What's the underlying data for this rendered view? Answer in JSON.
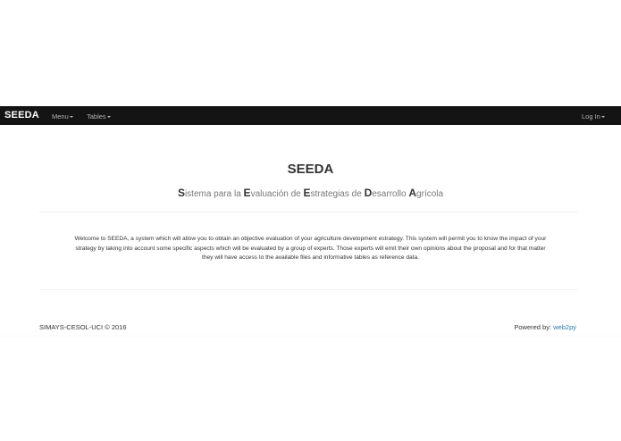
{
  "navbar": {
    "brand": "SEEDA",
    "menu_label": "Menu",
    "tables_label": "Tables",
    "login_label": "Log In"
  },
  "hero": {
    "title": "SEEDA",
    "subtitle": [
      {
        "cap": "S",
        "rest": "istema para la "
      },
      {
        "cap": "E",
        "rest": "valuación de "
      },
      {
        "cap": "E",
        "rest": "strategias de "
      },
      {
        "cap": "D",
        "rest": "esarrollo "
      },
      {
        "cap": "A",
        "rest": "grícola"
      }
    ]
  },
  "welcome": {
    "line1": "Welcome to SEEDA, a system which will allow you to obtain an objective evaluation of your agriculture development estrategy. This system will permit you to know the impact of your",
    "line2": "strategy by taking into account some specific aspects which will be evaluated by a group of experts. Those experts will emit their own opinions about the proposal and for that matter",
    "line3": "they will have access to the available files and informative tables as reference data."
  },
  "footer": {
    "copyright": "SIMAYS-CESOL-UCI © 2016",
    "powered_prefix": "Powered by: ",
    "powered_link": "web2py"
  },
  "colors": {
    "navbar_bg": "#141414",
    "link": "#2a7ab0"
  }
}
